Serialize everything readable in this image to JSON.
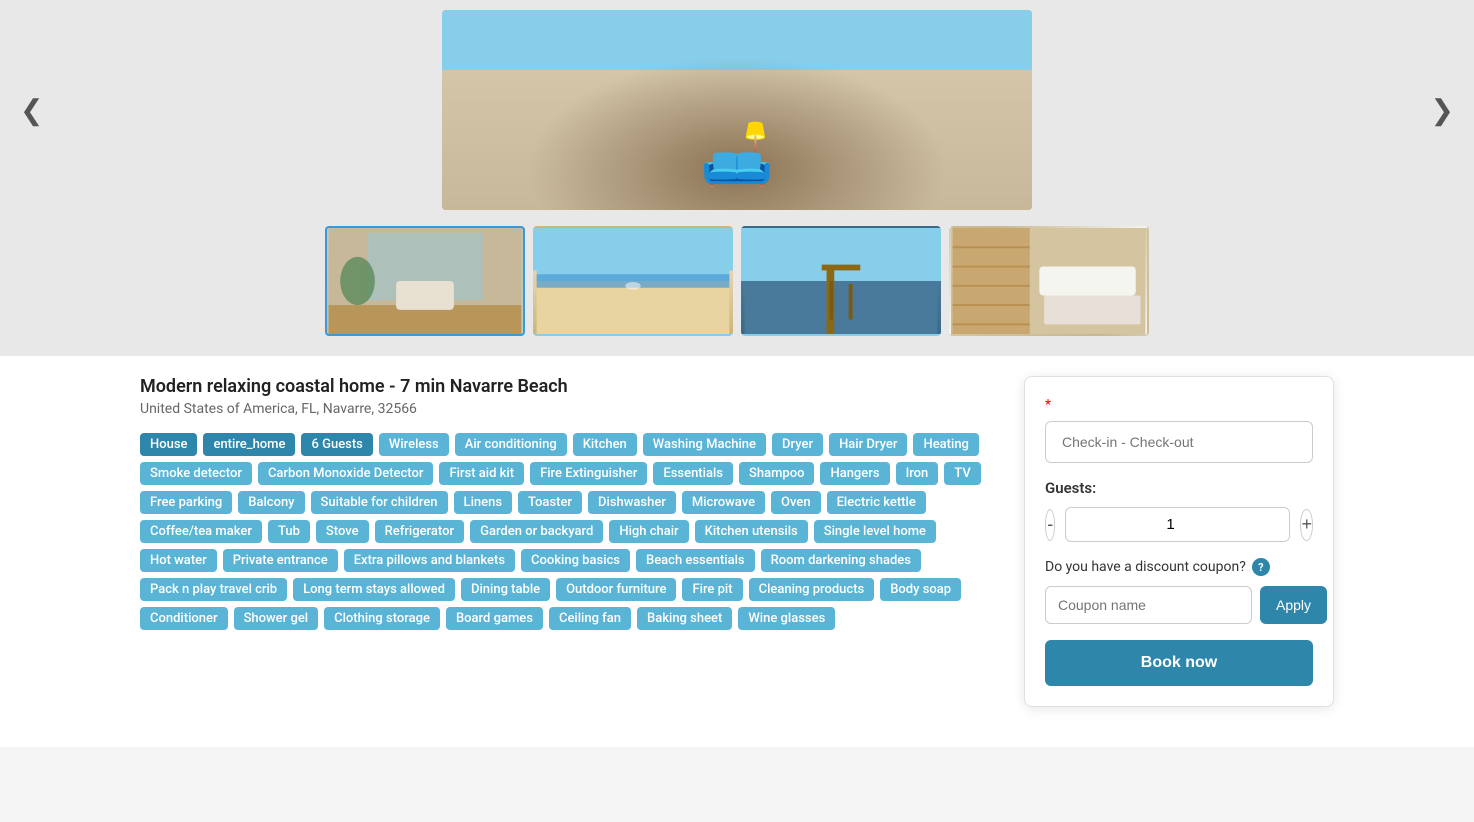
{
  "gallery": {
    "prev_arrow": "❮",
    "next_arrow": "❯",
    "thumbnails": [
      {
        "id": "thumb-1",
        "alt": "Living room interior",
        "active": true
      },
      {
        "id": "thumb-2",
        "alt": "Beach view",
        "active": false
      },
      {
        "id": "thumb-3",
        "alt": "Pier view",
        "active": false
      },
      {
        "id": "thumb-4",
        "alt": "Bedroom",
        "active": false
      }
    ]
  },
  "listing": {
    "title": "Modern relaxing coastal home - 7 min Navarre Beach",
    "location": "United States of America, FL, Navarre, 32566",
    "tags": [
      {
        "label": "House",
        "style": "primary"
      },
      {
        "label": "entire_home",
        "style": "primary"
      },
      {
        "label": "6 Guests",
        "style": "primary"
      },
      {
        "label": "Wireless",
        "style": "secondary"
      },
      {
        "label": "Air conditioning",
        "style": "secondary"
      },
      {
        "label": "Kitchen",
        "style": "secondary"
      },
      {
        "label": "Washing Machine",
        "style": "secondary"
      },
      {
        "label": "Dryer",
        "style": "secondary"
      },
      {
        "label": "Hair Dryer",
        "style": "secondary"
      },
      {
        "label": "Heating",
        "style": "secondary"
      },
      {
        "label": "Smoke detector",
        "style": "secondary"
      },
      {
        "label": "Carbon Monoxide Detector",
        "style": "secondary"
      },
      {
        "label": "First aid kit",
        "style": "secondary"
      },
      {
        "label": "Fire Extinguisher",
        "style": "secondary"
      },
      {
        "label": "Essentials",
        "style": "secondary"
      },
      {
        "label": "Shampoo",
        "style": "secondary"
      },
      {
        "label": "Hangers",
        "style": "secondary"
      },
      {
        "label": "Iron",
        "style": "secondary"
      },
      {
        "label": "TV",
        "style": "secondary"
      },
      {
        "label": "Free parking",
        "style": "secondary"
      },
      {
        "label": "Balcony",
        "style": "secondary"
      },
      {
        "label": "Suitable for children",
        "style": "secondary"
      },
      {
        "label": "Linens",
        "style": "secondary"
      },
      {
        "label": "Toaster",
        "style": "secondary"
      },
      {
        "label": "Dishwasher",
        "style": "secondary"
      },
      {
        "label": "Microwave",
        "style": "secondary"
      },
      {
        "label": "Oven",
        "style": "secondary"
      },
      {
        "label": "Electric kettle",
        "style": "secondary"
      },
      {
        "label": "Coffee/tea maker",
        "style": "secondary"
      },
      {
        "label": "Tub",
        "style": "secondary"
      },
      {
        "label": "Stove",
        "style": "secondary"
      },
      {
        "label": "Refrigerator",
        "style": "secondary"
      },
      {
        "label": "Garden or backyard",
        "style": "secondary"
      },
      {
        "label": "High chair",
        "style": "secondary"
      },
      {
        "label": "Kitchen utensils",
        "style": "secondary"
      },
      {
        "label": "Single level home",
        "style": "secondary"
      },
      {
        "label": "Hot water",
        "style": "secondary"
      },
      {
        "label": "Private entrance",
        "style": "secondary"
      },
      {
        "label": "Extra pillows and blankets",
        "style": "secondary"
      },
      {
        "label": "Cooking basics",
        "style": "secondary"
      },
      {
        "label": "Beach essentials",
        "style": "secondary"
      },
      {
        "label": "Room darkening shades",
        "style": "secondary"
      },
      {
        "label": "Pack n play travel crib",
        "style": "secondary"
      },
      {
        "label": "Long term stays allowed",
        "style": "secondary"
      },
      {
        "label": "Dining table",
        "style": "secondary"
      },
      {
        "label": "Outdoor furniture",
        "style": "secondary"
      },
      {
        "label": "Fire pit",
        "style": "secondary"
      },
      {
        "label": "Cleaning products",
        "style": "secondary"
      },
      {
        "label": "Body soap",
        "style": "secondary"
      },
      {
        "label": "Conditioner",
        "style": "secondary"
      },
      {
        "label": "Shower gel",
        "style": "secondary"
      },
      {
        "label": "Clothing storage",
        "style": "secondary"
      },
      {
        "label": "Board games",
        "style": "secondary"
      },
      {
        "label": "Ceiling fan",
        "style": "secondary"
      },
      {
        "label": "Baking sheet",
        "style": "secondary"
      },
      {
        "label": "Wine glasses",
        "style": "secondary"
      }
    ]
  },
  "booking": {
    "required_mark": "*",
    "date_placeholder": "Check-in - Check-out",
    "guests_label": "Guests:",
    "guests_value": "1",
    "guests_decrement": "-",
    "guests_increment": "+",
    "discount_label": "Do you have a discount coupon?",
    "help_icon": "?",
    "coupon_placeholder": "Coupon name",
    "apply_label": "Apply",
    "book_label": "Book now"
  }
}
